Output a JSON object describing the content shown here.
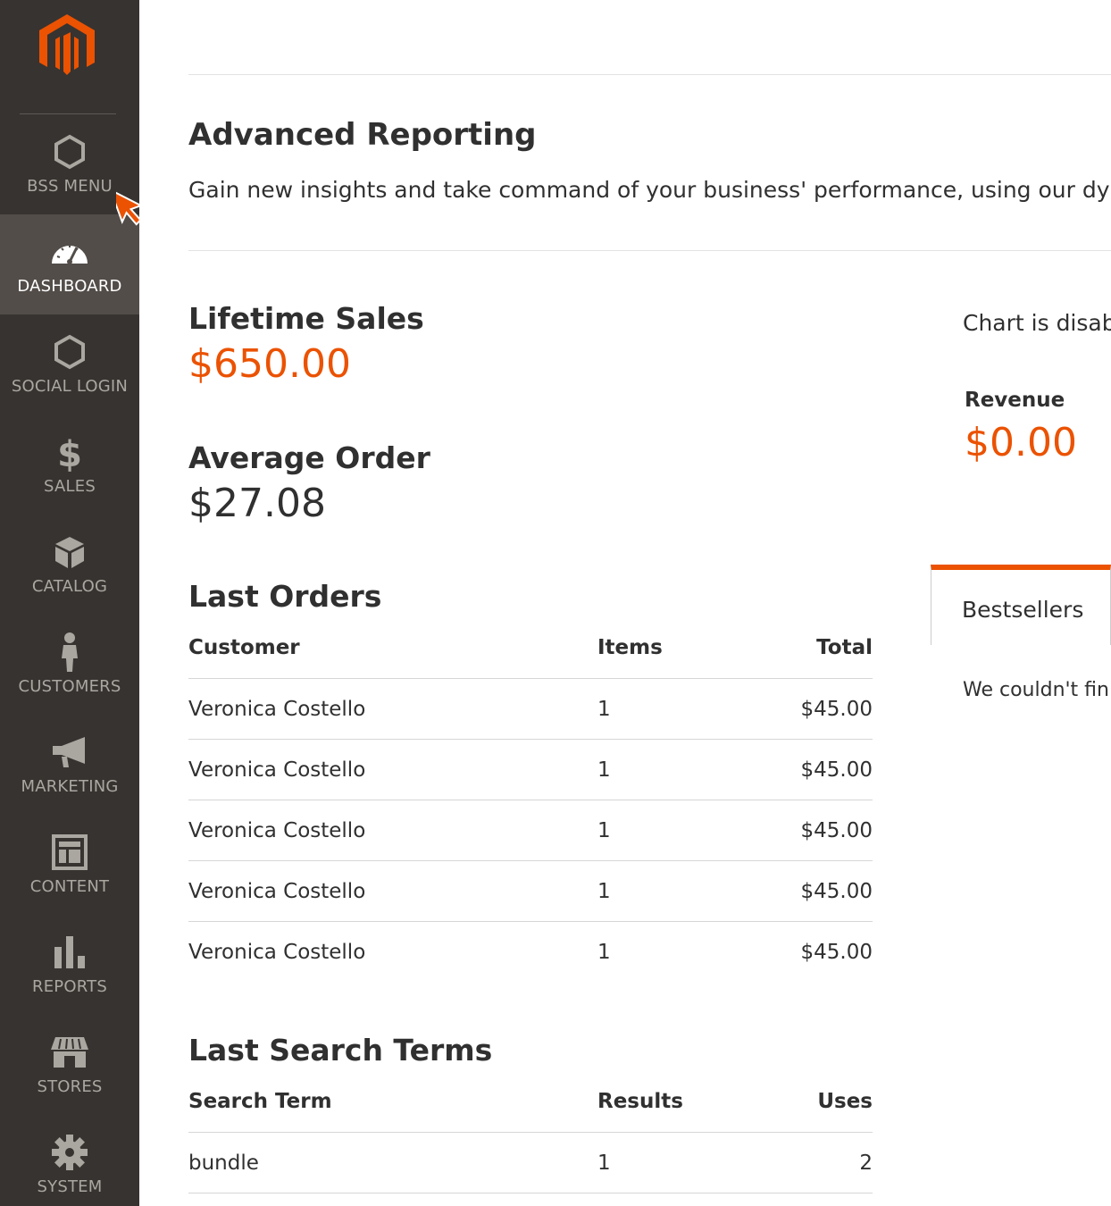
{
  "sidebar": {
    "logo": "magento-logo",
    "items": [
      {
        "label": "BSS MENU",
        "icon": "hexagon-icon",
        "active": false
      },
      {
        "label": "DASHBOARD",
        "icon": "speedometer-icon",
        "active": true
      },
      {
        "label": "SOCIAL LOGIN",
        "icon": "hexagon-icon",
        "active": false
      },
      {
        "label": "SALES",
        "icon": "dollar-icon",
        "active": false
      },
      {
        "label": "CATALOG",
        "icon": "box-icon",
        "active": false
      },
      {
        "label": "CUSTOMERS",
        "icon": "person-icon",
        "active": false
      },
      {
        "label": "MARKETING",
        "icon": "megaphone-icon",
        "active": false
      },
      {
        "label": "CONTENT",
        "icon": "layout-icon",
        "active": false
      },
      {
        "label": "REPORTS",
        "icon": "bar-chart-icon",
        "active": false
      },
      {
        "label": "STORES",
        "icon": "storefront-icon",
        "active": false
      },
      {
        "label": "SYSTEM",
        "icon": "gear-icon",
        "active": false
      }
    ]
  },
  "advanced_reporting": {
    "title": "Advanced Reporting",
    "description": "Gain new insights and take command of your business' performance, using our dynami"
  },
  "stats": {
    "lifetime_sales_label": "Lifetime Sales",
    "lifetime_sales_value": "$650.00",
    "average_order_label": "Average Order",
    "average_order_value": "$27.08"
  },
  "last_orders": {
    "title": "Last Orders",
    "columns": [
      "Customer",
      "Items",
      "Total"
    ],
    "rows": [
      [
        "Veronica Costello",
        "1",
        "$45.00"
      ],
      [
        "Veronica Costello",
        "1",
        "$45.00"
      ],
      [
        "Veronica Costello",
        "1",
        "$45.00"
      ],
      [
        "Veronica Costello",
        "1",
        "$45.00"
      ],
      [
        "Veronica Costello",
        "1",
        "$45.00"
      ]
    ]
  },
  "last_search_terms": {
    "title": "Last Search Terms",
    "columns": [
      "Search Term",
      "Results",
      "Uses"
    ],
    "rows": [
      [
        "bundle",
        "1",
        "2"
      ]
    ]
  },
  "chart": {
    "message": "Chart is disabl",
    "revenue_label": "Revenue",
    "revenue_value": "$0.00"
  },
  "tabs": {
    "bestsellers_label": "Bestsellers",
    "empty_message": "We couldn't fin"
  },
  "colors": {
    "accent": "#eb5202",
    "sidebar_bg": "#373330",
    "sidebar_active_bg": "#524d49"
  }
}
